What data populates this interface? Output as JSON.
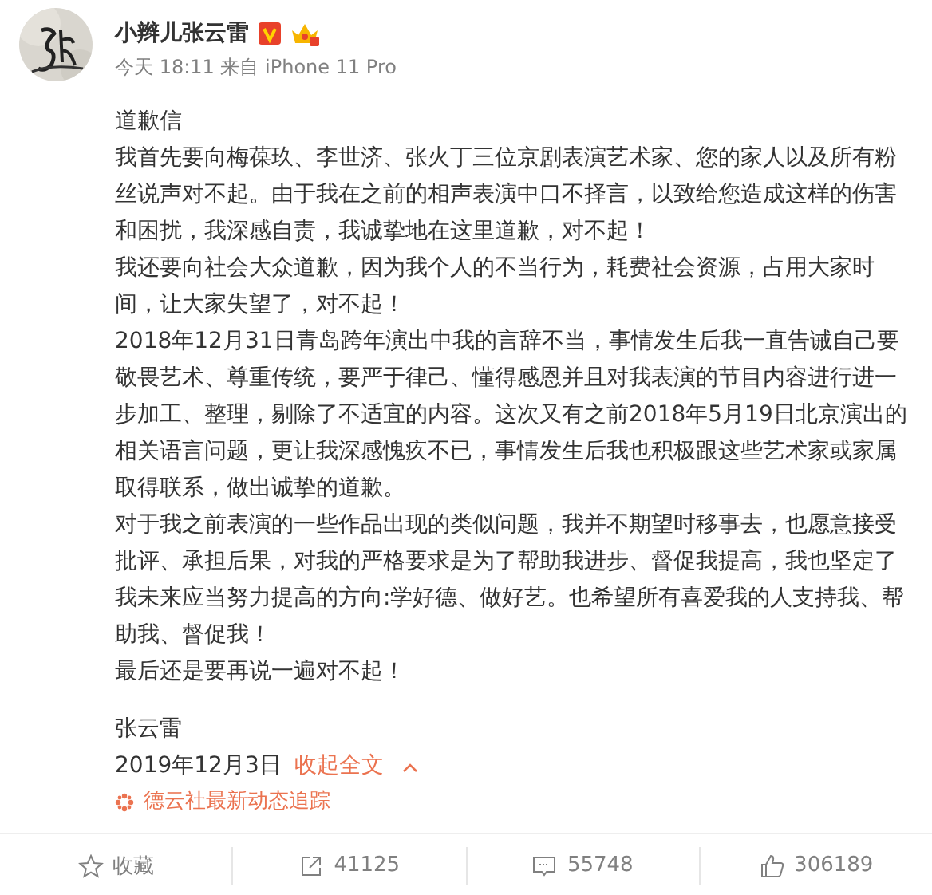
{
  "post": {
    "author": "小辫儿张云雷",
    "meta": "今天 18:11 来自 iPhone 11 Pro",
    "verified": true,
    "paragraphs": [
      "道歉信",
      "我首先要向梅葆玖、李世济、张火丁三位京剧表演艺术家、您的家人以及所有粉丝说声对不起。由于我在之前的相声表演中口不择言，以致给您造成这样的伤害和困扰，我深感自责，我诚挚地在这里道歉，对不起！",
      "我还要向社会大众道歉，因为我个人的不当行为，耗费社会资源，占用大家时间，让大家失望了，对不起！",
      "2018年12月31日青岛跨年演出中我的言辞不当，事情发生后我一直告诫自己要敬畏艺术、尊重传统，要严于律己、懂得感恩并且对我表演的节目内容进行进一步加工、整理，剔除了不适宜的内容。这次又有之前2018年5月19日北京演出的相关语言问题，更让我深感愧疚不已，事情发生后我也积极跟这些艺术家或家属取得联系，做出诚挚的道歉。",
      "对于我之前表演的一些作品出现的类似问题，我并不期望时移事去，也愿意接受批评、承担后果，对我的严格要求是为了帮助我进步、督促我提高，我也坚定了我未来应当努力提高的方向:学好德、做好艺。也希望所有喜爱我的人支持我、帮助我、督促我！",
      "最后还是要再说一遍对不起！"
    ],
    "signature": "张云雷",
    "date": "2019年12月3日",
    "collapse": "收起全文",
    "topic": "德云社最新动态追踪"
  },
  "actions": [
    {
      "kind": "favorite",
      "label": "收藏"
    },
    {
      "kind": "repost",
      "label": "41125"
    },
    {
      "kind": "comment",
      "label": "55748"
    },
    {
      "kind": "like",
      "label": "306189"
    }
  ]
}
